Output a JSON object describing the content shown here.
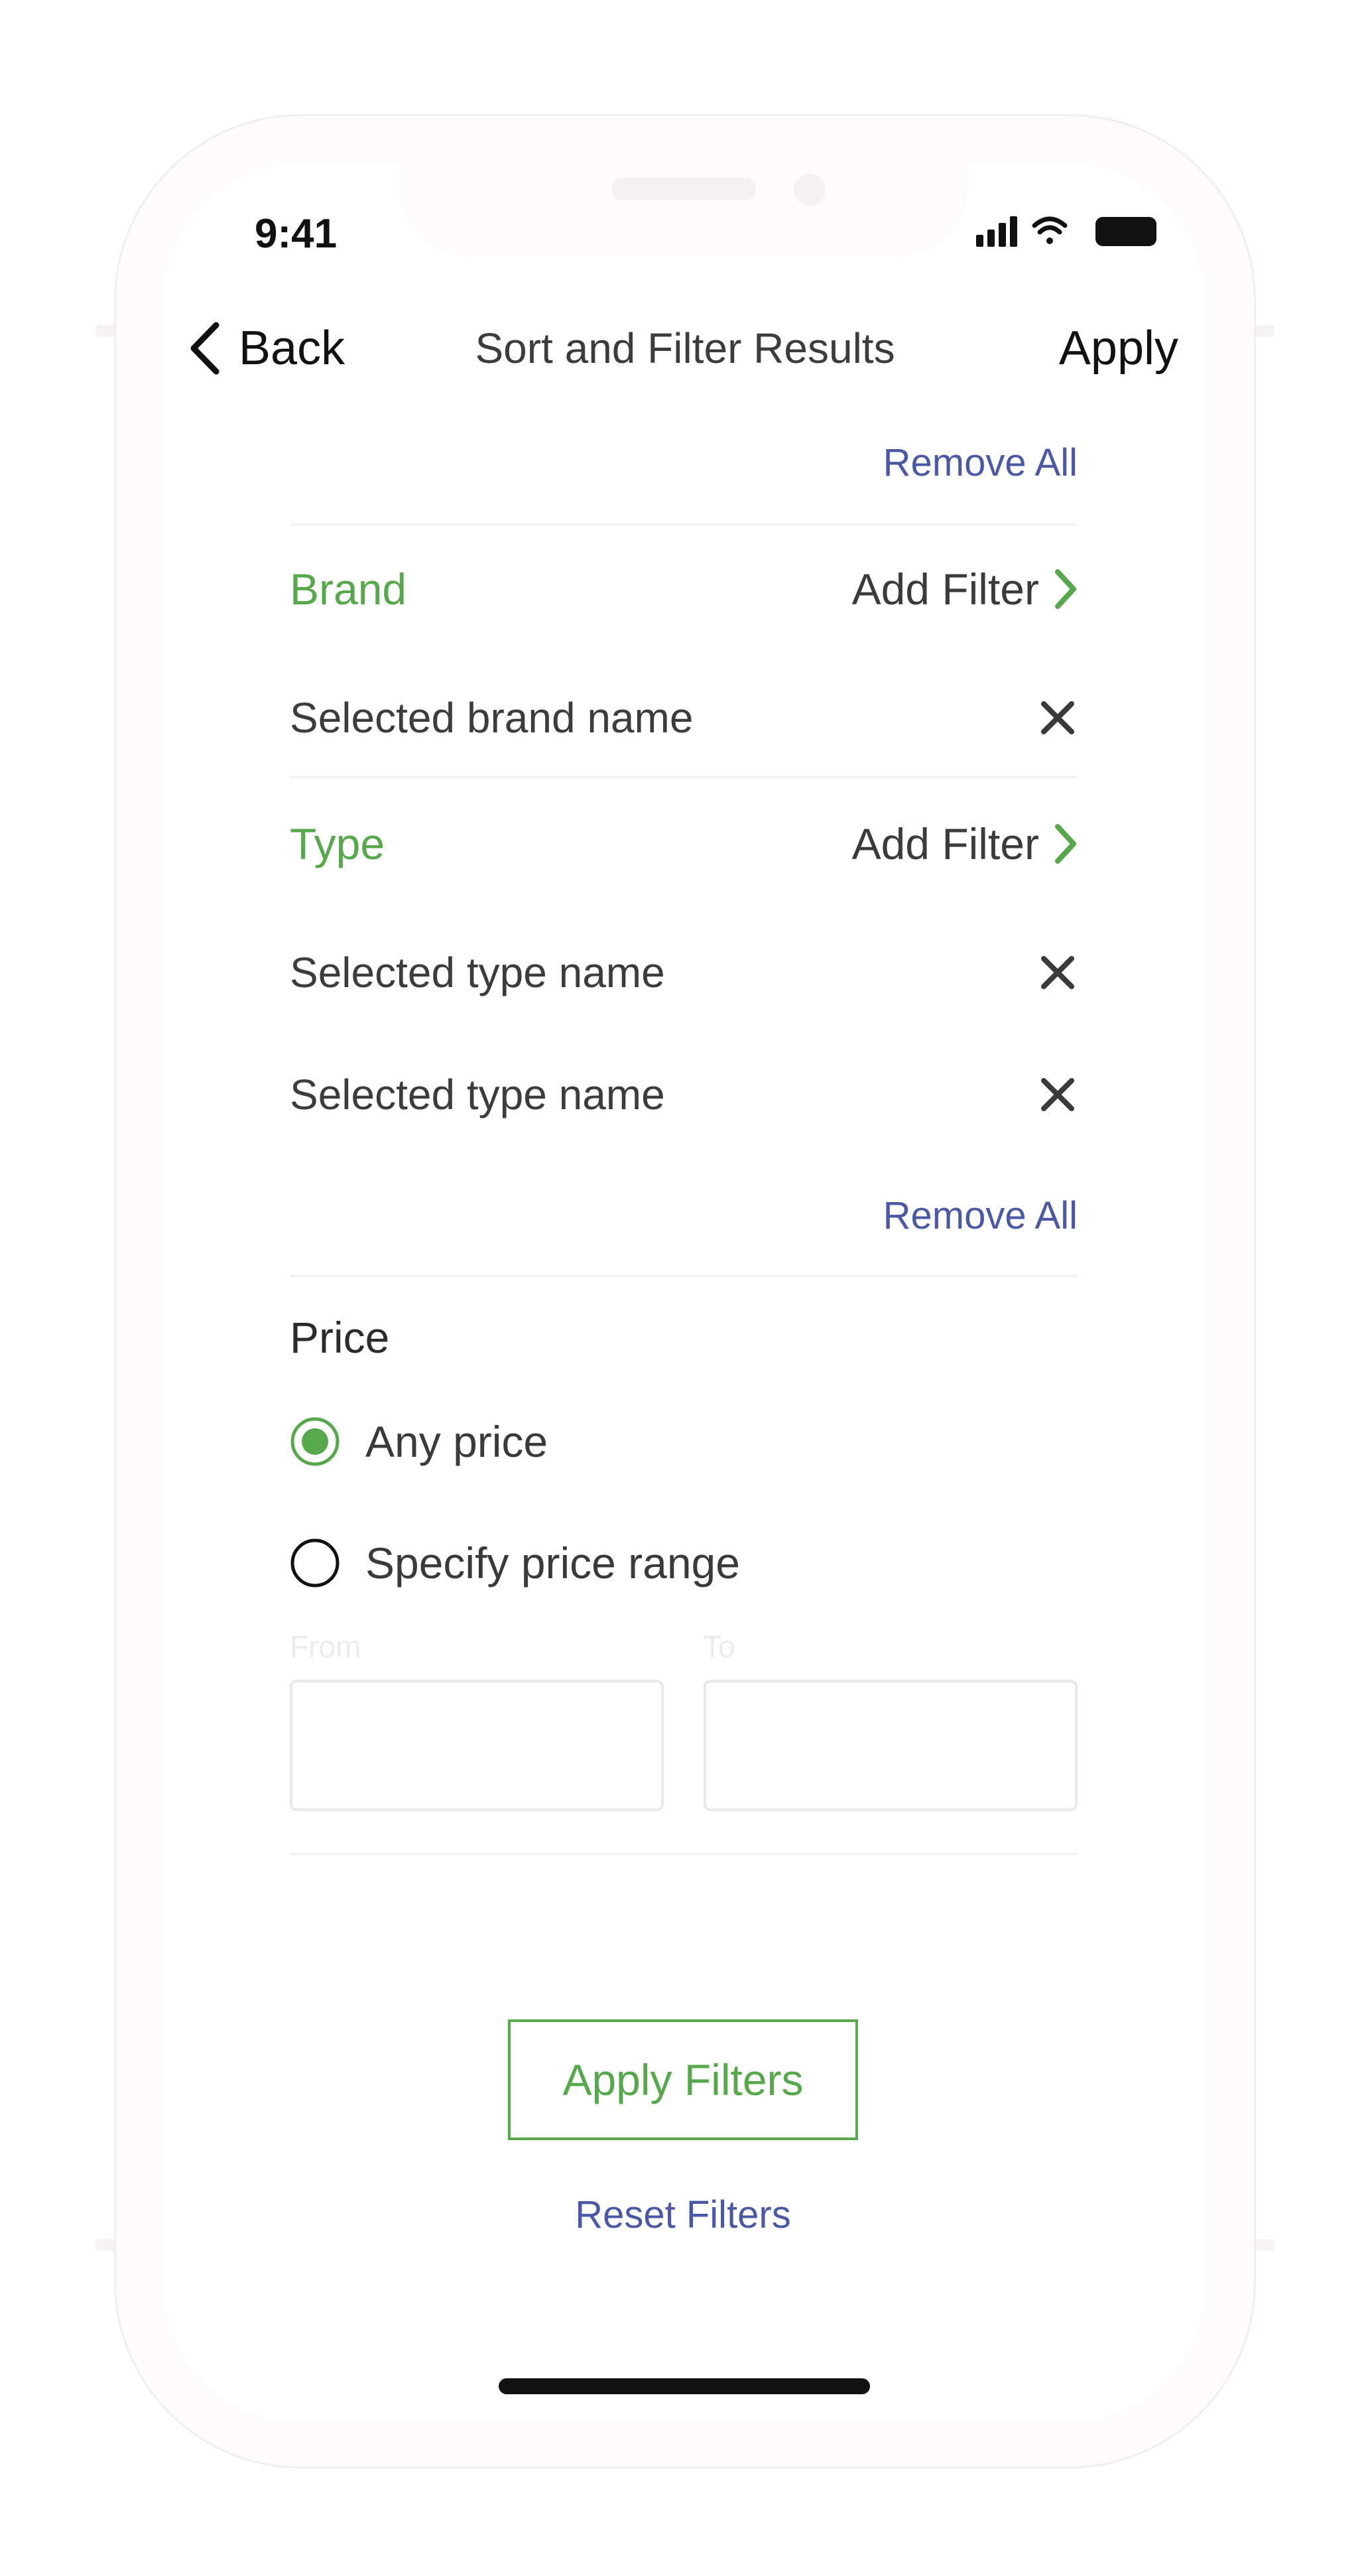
{
  "status_bar": {
    "time": "9:41"
  },
  "nav": {
    "back_label": "Back",
    "title": "Sort and Filter Results",
    "apply_label": "Apply"
  },
  "filters": {
    "remove_all_label": "Remove All",
    "brand": {
      "label": "Brand",
      "add_filter_label": "Add Filter",
      "items": [
        {
          "label": "Selected brand name"
        }
      ]
    },
    "type": {
      "label": "Type",
      "add_filter_label": "Add Filter",
      "items": [
        {
          "label": "Selected type name"
        },
        {
          "label": "Selected type name"
        }
      ],
      "remove_all_label": "Remove All"
    }
  },
  "price": {
    "title": "Price",
    "options": [
      {
        "label": "Any price",
        "selected": true
      },
      {
        "label": "Specify price range",
        "selected": false
      }
    ],
    "from_label": "From",
    "to_label": "To",
    "from_value": "",
    "to_value": ""
  },
  "actions": {
    "apply_filters_label": "Apply Filters",
    "reset_filters_label": "Reset Filters"
  },
  "colors": {
    "accent_green": "#55a94a",
    "link_blue": "#4a58a6"
  },
  "icons": [
    "signal-icon",
    "wifi-icon",
    "battery-icon",
    "chevron-left-icon",
    "chevron-right-icon",
    "close-icon",
    "radio-selected-icon",
    "radio-unselected-icon"
  ]
}
